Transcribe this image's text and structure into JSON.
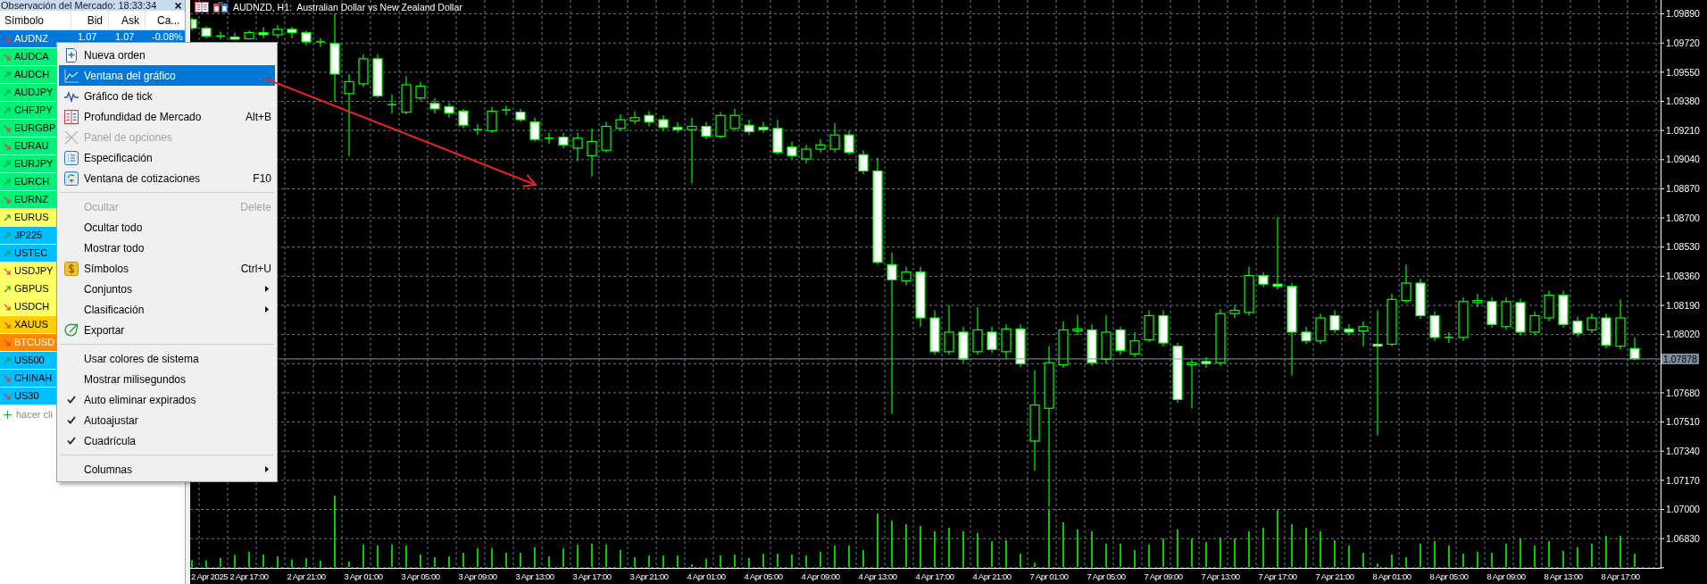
{
  "market_watch": {
    "title": "Observación del Mercado: 18:33:34",
    "columns": [
      "Símbolo",
      "Bid",
      "Ask",
      "Ca..."
    ],
    "rows": [
      {
        "symbol": "AUDNZ",
        "kind": "down",
        "selected": true,
        "bid": "1.07",
        "ask": "1.07",
        "change": "-0.08%"
      },
      {
        "symbol": "AUDCA",
        "kind": "down",
        "selected": false,
        "color": "#00f078"
      },
      {
        "symbol": "AUDCH",
        "kind": "up",
        "selected": false,
        "color": "#00f078"
      },
      {
        "symbol": "AUDJPY",
        "kind": "up",
        "selected": false,
        "color": "#00f078"
      },
      {
        "symbol": "CHFJPY",
        "kind": "up",
        "selected": false,
        "color": "#00f078"
      },
      {
        "symbol": "EURGBP",
        "kind": "down",
        "selected": false,
        "color": "#00f078"
      },
      {
        "symbol": "EURAU",
        "kind": "down",
        "selected": false,
        "color": "#00f078"
      },
      {
        "symbol": "EURJPY",
        "kind": "up",
        "selected": false,
        "color": "#00f078"
      },
      {
        "symbol": "EURCH",
        "kind": "up",
        "selected": false,
        "color": "#00f078"
      },
      {
        "symbol": "EURNZ",
        "kind": "down",
        "selected": false,
        "color": "#00f078"
      },
      {
        "symbol": "EURUS",
        "kind": "up",
        "selected": false,
        "color": "#ffff66"
      },
      {
        "symbol": "JP225",
        "kind": "up",
        "selected": false,
        "color": "#00bfff"
      },
      {
        "symbol": "USTEC",
        "kind": "up",
        "selected": false,
        "color": "#00bfff"
      },
      {
        "symbol": "USDJPY",
        "kind": "down",
        "selected": false,
        "color": "#ffff66"
      },
      {
        "symbol": "GBPUS",
        "kind": "up",
        "selected": false,
        "color": "#ffff66"
      },
      {
        "symbol": "USDCH",
        "kind": "down",
        "selected": false,
        "color": "#ffff66"
      },
      {
        "symbol": "XAUUS",
        "kind": "down",
        "selected": false,
        "color": "#ffcc00"
      },
      {
        "symbol": "BTCUSD",
        "kind": "down",
        "selected": false,
        "color": "#ff8800"
      },
      {
        "symbol": "US500",
        "kind": "up",
        "selected": false,
        "color": "#00bfff"
      },
      {
        "symbol": "CHINAH",
        "kind": "down",
        "selected": false,
        "color": "#00bfff"
      },
      {
        "symbol": "US30",
        "kind": "down",
        "selected": false,
        "color": "#00bfff"
      }
    ],
    "add_symbol": {
      "placeholder": "hacer cli"
    }
  },
  "chart": {
    "axis_start_label": "2 Apr 2025",
    "chart_data": {
      "type": "candlestick",
      "title": "AUDNZD, H1:  Australian Dollar vs New Zealand Dollar",
      "categories": [
        null,
        null,
        null,
        null,
        "2 Apr 17:00",
        null,
        null,
        null,
        "2 Apr 21:00",
        null,
        null,
        null,
        "3 Apr 01:00",
        null,
        null,
        null,
        "3 Apr 05:00",
        null,
        null,
        null,
        "3 Apr 09:00",
        null,
        null,
        null,
        "3 Apr 13:00",
        null,
        null,
        null,
        "3 Apr 17:00",
        null,
        null,
        null,
        "3 Apr 21:00",
        null,
        null,
        null,
        "4 Apr 01:00",
        null,
        null,
        null,
        "4 Apr 05:00",
        null,
        null,
        null,
        "4 Apr 09:00",
        null,
        null,
        null,
        "4 Apr 13:00",
        null,
        null,
        null,
        "4 Apr 17:00",
        null,
        null,
        null,
        "4 Apr 21:00",
        null,
        null,
        null,
        "7 Apr 01:00",
        null,
        null,
        null,
        "7 Apr 05:00",
        null,
        null,
        null,
        "7 Apr 09:00",
        null,
        null,
        null,
        "7 Apr 13:00",
        null,
        null,
        null,
        "7 Apr 17:00",
        null,
        null,
        null,
        "7 Apr 21:00",
        null,
        null,
        null,
        "8 Apr 01:00",
        null,
        null,
        null,
        "8 Apr 05:00",
        null,
        null,
        null,
        "8 Apr 09:00",
        null,
        null,
        null,
        "8 Apr 13:00",
        null,
        null,
        null,
        "8 Apr 17:00",
        null
      ],
      "ohlc": [
        [
          1.09857,
          1.09869,
          1.09793,
          1.09806
        ],
        [
          1.09806,
          1.09819,
          1.09749,
          1.09761
        ],
        [
          1.09761,
          1.09787,
          1.0974,
          1.09761
        ],
        [
          1.09755,
          1.09781,
          1.0974,
          1.09742
        ],
        [
          1.09745,
          1.09793,
          1.0974,
          1.09781
        ],
        [
          1.09781,
          1.09812,
          1.09749,
          1.09768
        ],
        [
          1.09768,
          1.09825,
          1.09749,
          1.098
        ],
        [
          1.098,
          1.09815,
          1.09749,
          1.09781
        ],
        [
          1.09781,
          1.09793,
          1.09704,
          1.09727
        ],
        [
          1.09727,
          1.09749,
          1.09698,
          1.09727
        ],
        [
          1.09717,
          1.09892,
          1.0938,
          1.09539
        ],
        [
          1.09425,
          1.09539,
          1.09063,
          1.09495
        ],
        [
          1.09482,
          1.09654,
          1.09463,
          1.09628
        ],
        [
          1.09628,
          1.09654,
          1.094,
          1.09412
        ],
        [
          1.09361,
          1.09419,
          1.09311,
          1.09355
        ],
        [
          1.09317,
          1.09527,
          1.09304,
          1.09476
        ],
        [
          1.094,
          1.09495,
          1.09387,
          1.09469
        ],
        [
          1.09368,
          1.094,
          1.09311,
          1.09336
        ],
        [
          1.09349,
          1.09374,
          1.09285,
          1.09311
        ],
        [
          1.09323,
          1.09336,
          1.09222,
          1.09241
        ],
        [
          1.09215,
          1.09247,
          1.09184,
          1.09209
        ],
        [
          1.09209,
          1.09349,
          1.09196,
          1.09323
        ],
        [
          1.09323,
          1.09355,
          1.09298,
          1.0933
        ],
        [
          1.09317,
          1.09336,
          1.0926,
          1.09273
        ],
        [
          1.0926,
          1.09285,
          1.09146,
          1.09158
        ],
        [
          1.09165,
          1.09196,
          1.09133,
          1.09158
        ],
        [
          1.09171,
          1.09196,
          1.09107,
          1.09126
        ],
        [
          1.09107,
          1.09196,
          1.09031,
          1.09165
        ],
        [
          1.09063,
          1.09222,
          1.08942,
          1.09146
        ],
        [
          1.09095,
          1.0926,
          1.09082,
          1.09234
        ],
        [
          1.09222,
          1.09304,
          1.09209,
          1.09273
        ],
        [
          1.09266,
          1.09323,
          1.09247,
          1.09285
        ],
        [
          1.09298,
          1.09323,
          1.09234,
          1.0926
        ],
        [
          1.09273,
          1.09298,
          1.09209,
          1.09228
        ],
        [
          1.09228,
          1.0926,
          1.09196,
          1.09215
        ],
        [
          1.09215,
          1.09285,
          1.08904,
          1.09234
        ],
        [
          1.09234,
          1.0926,
          1.09158,
          1.09177
        ],
        [
          1.09177,
          1.09317,
          1.09165,
          1.09298
        ],
        [
          1.09222,
          1.09336,
          1.09209,
          1.09298
        ],
        [
          1.09241,
          1.09273,
          1.09184,
          1.09203
        ],
        [
          1.09228,
          1.0926,
          1.09196,
          1.09215
        ],
        [
          1.09222,
          1.09273,
          1.09069,
          1.09082
        ],
        [
          1.09114,
          1.09146,
          1.09044,
          1.09063
        ],
        [
          1.09044,
          1.09126,
          1.09019,
          1.09101
        ],
        [
          1.09101,
          1.09158,
          1.09082,
          1.09126
        ],
        [
          1.09101,
          1.09253,
          1.09082,
          1.09184
        ],
        [
          1.09184,
          1.09209,
          1.09069,
          1.09082
        ],
        [
          1.09069,
          1.09095,
          1.08955,
          1.08974
        ],
        [
          1.08974,
          1.0905,
          1.08428,
          1.08441
        ],
        [
          1.08428,
          1.08498,
          1.07558,
          1.08339
        ],
        [
          1.08333,
          1.08415,
          1.08307,
          1.08384
        ],
        [
          1.08384,
          1.08415,
          1.08066,
          1.08117
        ],
        [
          1.08117,
          1.08161,
          1.07901,
          1.0792
        ],
        [
          1.0792,
          1.08193,
          1.07901,
          1.08034
        ],
        [
          1.08034,
          1.08066,
          1.07856,
          1.07876
        ],
        [
          1.0792,
          1.0818,
          1.07901,
          1.08047
        ],
        [
          1.08034,
          1.08066,
          1.07914,
          1.07933
        ],
        [
          1.0792,
          1.08079,
          1.07876,
          1.08053
        ],
        [
          1.08053,
          1.08079,
          1.07831,
          1.0785
        ],
        [
          1.07399,
          1.07812,
          1.07228,
          1.07609
        ],
        [
          1.0759,
          1.07952,
          1.07018,
          1.07856
        ],
        [
          1.07844,
          1.08098,
          1.07825,
          1.08047
        ],
        [
          1.08041,
          1.0813,
          1.08015,
          1.08053
        ],
        [
          1.08047,
          1.08079,
          1.07837,
          1.07856
        ],
        [
          1.07876,
          1.0813,
          1.0785,
          1.08034
        ],
        [
          1.08047,
          1.08066,
          1.07901,
          1.07926
        ],
        [
          1.07907,
          1.08034,
          1.07888,
          1.07983
        ],
        [
          1.0799,
          1.08161,
          1.07977,
          1.0813
        ],
        [
          1.0813,
          1.08161,
          1.07952,
          1.07971
        ],
        [
          1.07952,
          1.07971,
          1.07622,
          1.07641
        ],
        [
          1.07844,
          1.07876,
          1.0759,
          1.07856
        ],
        [
          1.07863,
          1.07888,
          1.07825,
          1.0785
        ],
        [
          1.07856,
          1.08168,
          1.07837,
          1.08142
        ],
        [
          1.08142,
          1.08193,
          1.08117,
          1.08161
        ],
        [
          1.08149,
          1.08415,
          1.0813,
          1.08364
        ],
        [
          1.08364,
          1.08384,
          1.08295,
          1.08314
        ],
        [
          1.08314,
          1.08701,
          1.08282,
          1.08301
        ],
        [
          1.08301,
          1.0832,
          1.0778,
          1.08034
        ],
        [
          1.08034,
          1.08066,
          1.07964,
          1.07983
        ],
        [
          1.07983,
          1.08142,
          1.07964,
          1.08117
        ],
        [
          1.0813,
          1.08161,
          1.08028,
          1.08047
        ],
        [
          1.08053,
          1.08079,
          1.08015,
          1.08034
        ],
        [
          1.08041,
          1.08098,
          1.07952,
          1.08066
        ],
        [
          1.07964,
          1.08161,
          1.07431,
          1.07952
        ],
        [
          1.07964,
          1.08257,
          1.07952,
          1.08225
        ],
        [
          1.08218,
          1.08428,
          1.08206,
          1.0832
        ],
        [
          1.0832,
          1.08345,
          1.0811,
          1.0813
        ],
        [
          1.0813,
          1.08155,
          1.07983,
          1.08003
        ],
        [
          1.08003,
          1.08034,
          1.07971,
          1.07996
        ],
        [
          1.08003,
          1.08237,
          1.07983,
          1.08212
        ],
        [
          1.08206,
          1.08257,
          1.0818,
          1.08218
        ],
        [
          1.08212,
          1.08237,
          1.0806,
          1.08079
        ],
        [
          1.08066,
          1.08237,
          1.08047,
          1.08212
        ],
        [
          1.08206,
          1.08231,
          1.08015,
          1.08034
        ],
        [
          1.08034,
          1.08155,
          1.08015,
          1.0813
        ],
        [
          1.08117,
          1.08276,
          1.08098,
          1.0825
        ],
        [
          1.0825,
          1.08276,
          1.0806,
          1.08079
        ],
        [
          1.08098,
          1.08123,
          1.08009,
          1.08028
        ],
        [
          1.08047,
          1.08142,
          1.08028,
          1.08117
        ],
        [
          1.08117,
          1.08142,
          1.07939,
          1.07958
        ],
        [
          1.07952,
          1.08225,
          1.07933,
          1.08117
        ],
        [
          1.07939,
          1.08003,
          1.0787,
          1.07878
        ]
      ],
      "ylim": [
        1.06659,
        1.09971
      ],
      "yticks": [
        {
          "value": 1.0989,
          "label": "1.09890"
        },
        {
          "value": 1.0972,
          "label": "1.09720"
        },
        {
          "value": 1.0955,
          "label": "1.09550"
        },
        {
          "value": 1.0938,
          "label": "1.09380"
        },
        {
          "value": 1.0921,
          "label": "1.09210"
        },
        {
          "value": 1.0904,
          "label": "1.09040"
        },
        {
          "value": 1.0887,
          "label": "1.08870"
        },
        {
          "value": 1.087,
          "label": "1.08700"
        },
        {
          "value": 1.0853,
          "label": "1.08530"
        },
        {
          "value": 1.0836,
          "label": "1.08360"
        },
        {
          "value": 1.0819,
          "label": "1.08190"
        },
        {
          "value": 1.0802,
          "label": "1.08020"
        },
        {
          "value": 1.0768,
          "label": "1.07680"
        },
        {
          "value": 1.0751,
          "label": "1.07510"
        },
        {
          "value": 1.0734,
          "label": "1.07340"
        },
        {
          "value": 1.0717,
          "label": "1.07170"
        },
        {
          "value": 1.07,
          "label": "1.07000"
        },
        {
          "value": 1.0683,
          "label": "1.06830"
        }
      ],
      "grid": true,
      "ref_lines": [
        {
          "axis": "y",
          "value": 1.07878,
          "label": "1.07878"
        }
      ]
    }
  },
  "context_menu": {
    "groups": [
      {
        "items": [
          {
            "label": "Nueva orden",
            "selected": false,
            "disabled": false,
            "checked": false,
            "submenu": false
          },
          {
            "label": "Ventana del gráfico",
            "selected": true,
            "disabled": false,
            "checked": false,
            "submenu": false
          },
          {
            "label": "Gráfico de tick",
            "selected": false,
            "disabled": false,
            "checked": false,
            "submenu": false
          },
          {
            "label": "Profundidad de Mercado",
            "shortcut": "Alt+B",
            "selected": false,
            "disabled": false,
            "checked": false,
            "submenu": false
          },
          {
            "label": "Panel de opciones",
            "selected": false,
            "disabled": true,
            "checked": false,
            "submenu": false
          },
          {
            "label": "Especificación",
            "selected": false,
            "disabled": false,
            "checked": false,
            "submenu": false
          },
          {
            "label": "Ventana de cotizaciones",
            "shortcut": "F10",
            "selected": false,
            "disabled": false,
            "checked": false,
            "submenu": false
          }
        ]
      },
      {
        "items": [
          {
            "label": "Ocultar",
            "shortcut": "Delete",
            "selected": false,
            "disabled": true,
            "checked": false,
            "submenu": false
          },
          {
            "label": "Ocultar todo",
            "selected": false,
            "disabled": false,
            "checked": false,
            "submenu": false
          },
          {
            "label": "Mostrar todo",
            "selected": false,
            "disabled": false,
            "checked": false,
            "submenu": false
          },
          {
            "label": "Símbolos",
            "shortcut": "Ctrl+U",
            "selected": false,
            "disabled": false,
            "checked": false,
            "submenu": false
          },
          {
            "label": "Conjuntos",
            "selected": false,
            "disabled": false,
            "checked": false,
            "submenu": true
          },
          {
            "label": "Clasificación",
            "selected": false,
            "disabled": false,
            "checked": false,
            "submenu": true
          },
          {
            "label": "Exportar",
            "selected": false,
            "disabled": false,
            "checked": false,
            "submenu": false
          }
        ]
      },
      {
        "items": [
          {
            "label": "Usar colores de sistema",
            "selected": false,
            "disabled": false,
            "checked": false,
            "submenu": false
          },
          {
            "label": "Mostrar milisegundos",
            "selected": false,
            "disabled": false,
            "checked": false,
            "submenu": false
          },
          {
            "label": "Auto eliminar expirados",
            "selected": false,
            "disabled": false,
            "checked": true,
            "submenu": false
          },
          {
            "label": "Autoajustar",
            "selected": false,
            "disabled": false,
            "checked": true,
            "submenu": false
          },
          {
            "label": "Cuadrícula",
            "selected": false,
            "disabled": false,
            "checked": true,
            "submenu": false
          }
        ]
      },
      {
        "items": [
          {
            "label": "Columnas",
            "selected": false,
            "disabled": false,
            "checked": false,
            "submenu": true
          }
        ]
      }
    ]
  }
}
